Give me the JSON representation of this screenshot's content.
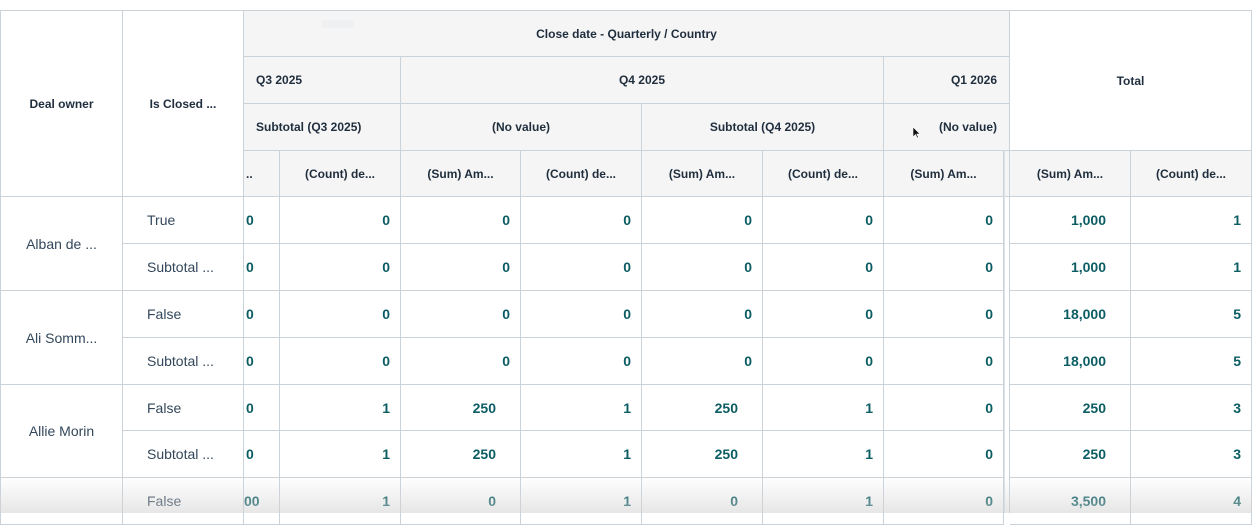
{
  "headers": {
    "deal_owner": "Deal owner",
    "is_closed": "Is Closed ...",
    "close_date_group": "Close date - Quarterly / Country",
    "q3": "Q3 2025",
    "q4": "Q4 2025",
    "q1": "Q1 2026",
    "total": "Total",
    "subtotal_q3": "Subtotal (Q3 2025)",
    "no_value_q4": "(No value)",
    "subtotal_q4": "Subtotal (Q4 2025)",
    "no_value_q1": "(No value)",
    "metrics": {
      "q3_sum_trunc": "..",
      "q3_count": "(Count) de...",
      "q4nv_sum": "(Sum) Am...",
      "q4nv_count": "(Count) de...",
      "q4sub_sum": "(Sum) Am...",
      "q4sub_count": "(Count) de...",
      "q1_sum": "(Sum) Am...",
      "total_sum": "(Sum) Am...",
      "total_count": "(Count) de..."
    }
  },
  "rows": [
    {
      "owner": "Alban de ...",
      "label": "True",
      "cells": [
        "0",
        "0",
        "0",
        "0",
        "0",
        "0",
        "0",
        "1,000",
        "1"
      ]
    },
    {
      "owner": "",
      "label": "Subtotal ...",
      "cells": [
        "0",
        "0",
        "0",
        "0",
        "0",
        "0",
        "0",
        "1,000",
        "1"
      ]
    },
    {
      "owner": "Ali Somm...",
      "label": "False",
      "cells": [
        "0",
        "0",
        "0",
        "0",
        "0",
        "0",
        "0",
        "18,000",
        "5"
      ]
    },
    {
      "owner": "",
      "label": "Subtotal ...",
      "cells": [
        "0",
        "0",
        "0",
        "0",
        "0",
        "0",
        "0",
        "18,000",
        "5"
      ]
    },
    {
      "owner": "Allie Morin",
      "label": "False",
      "cells": [
        "0",
        "1",
        "250",
        "1",
        "250",
        "1",
        "0",
        "250",
        "3"
      ]
    },
    {
      "owner": "",
      "label": "Subtotal ...",
      "cells": [
        "0",
        "1",
        "250",
        "1",
        "250",
        "1",
        "0",
        "250",
        "3"
      ]
    },
    {
      "owner": "",
      "label": "False",
      "cells": [
        "00",
        "1",
        "0",
        "1",
        "0",
        "1",
        "0",
        "3,500",
        "4"
      ]
    }
  ],
  "colors": {
    "accent_number": "#0b5d63",
    "header_bg": "#f5f5f5",
    "border": "#cbd3da"
  }
}
